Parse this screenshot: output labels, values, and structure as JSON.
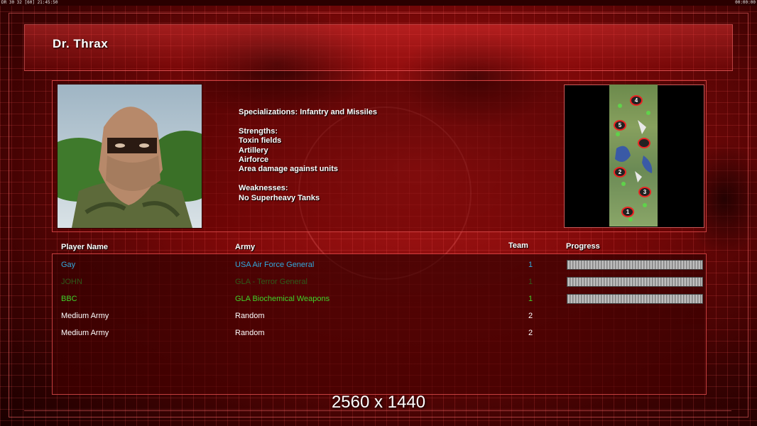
{
  "topbar": {
    "left_text": "DR 30 32 [60] 21:45:50",
    "right_text": "00:00:00"
  },
  "player": {
    "name": "Dr. Thrax"
  },
  "general": {
    "description": "Specializations: Infantry and Missiles\n\nStrengths:\nToxin fields\nArtillery\nAirforce\nArea damage against units\n\nWeaknesses:\nNo Superheavy Tanks"
  },
  "minimap": {
    "markers": [
      "4",
      "5",
      "",
      "2",
      "3",
      "1"
    ]
  },
  "table": {
    "headers": {
      "player": "Player Name",
      "army": "Army",
      "team": "Team",
      "progress": "Progress"
    },
    "rows": [
      {
        "name": "Gay",
        "army": "USA Air Force General",
        "team": "1",
        "color": "#33a9dc",
        "progress": 1.0
      },
      {
        "name": "JOHN",
        "army": "GLA - Terror General",
        "team": "1",
        "color": "#2e5a1a",
        "progress": 1.0
      },
      {
        "name": "BBC",
        "army": "GLA Biochemical Weapons",
        "team": "1",
        "color": "#3fd42a",
        "progress": 1.0
      },
      {
        "name": "Medium Army",
        "army": "Random",
        "team": "2",
        "color": "#ffffff"
      },
      {
        "name": "Medium Army",
        "army": "Random",
        "team": "2",
        "color": "#ffffff"
      }
    ]
  },
  "overlay": {
    "resolution": "2560 x 1440"
  },
  "colors": {
    "accent": "#b01818",
    "frame": "#ff6e6e"
  }
}
